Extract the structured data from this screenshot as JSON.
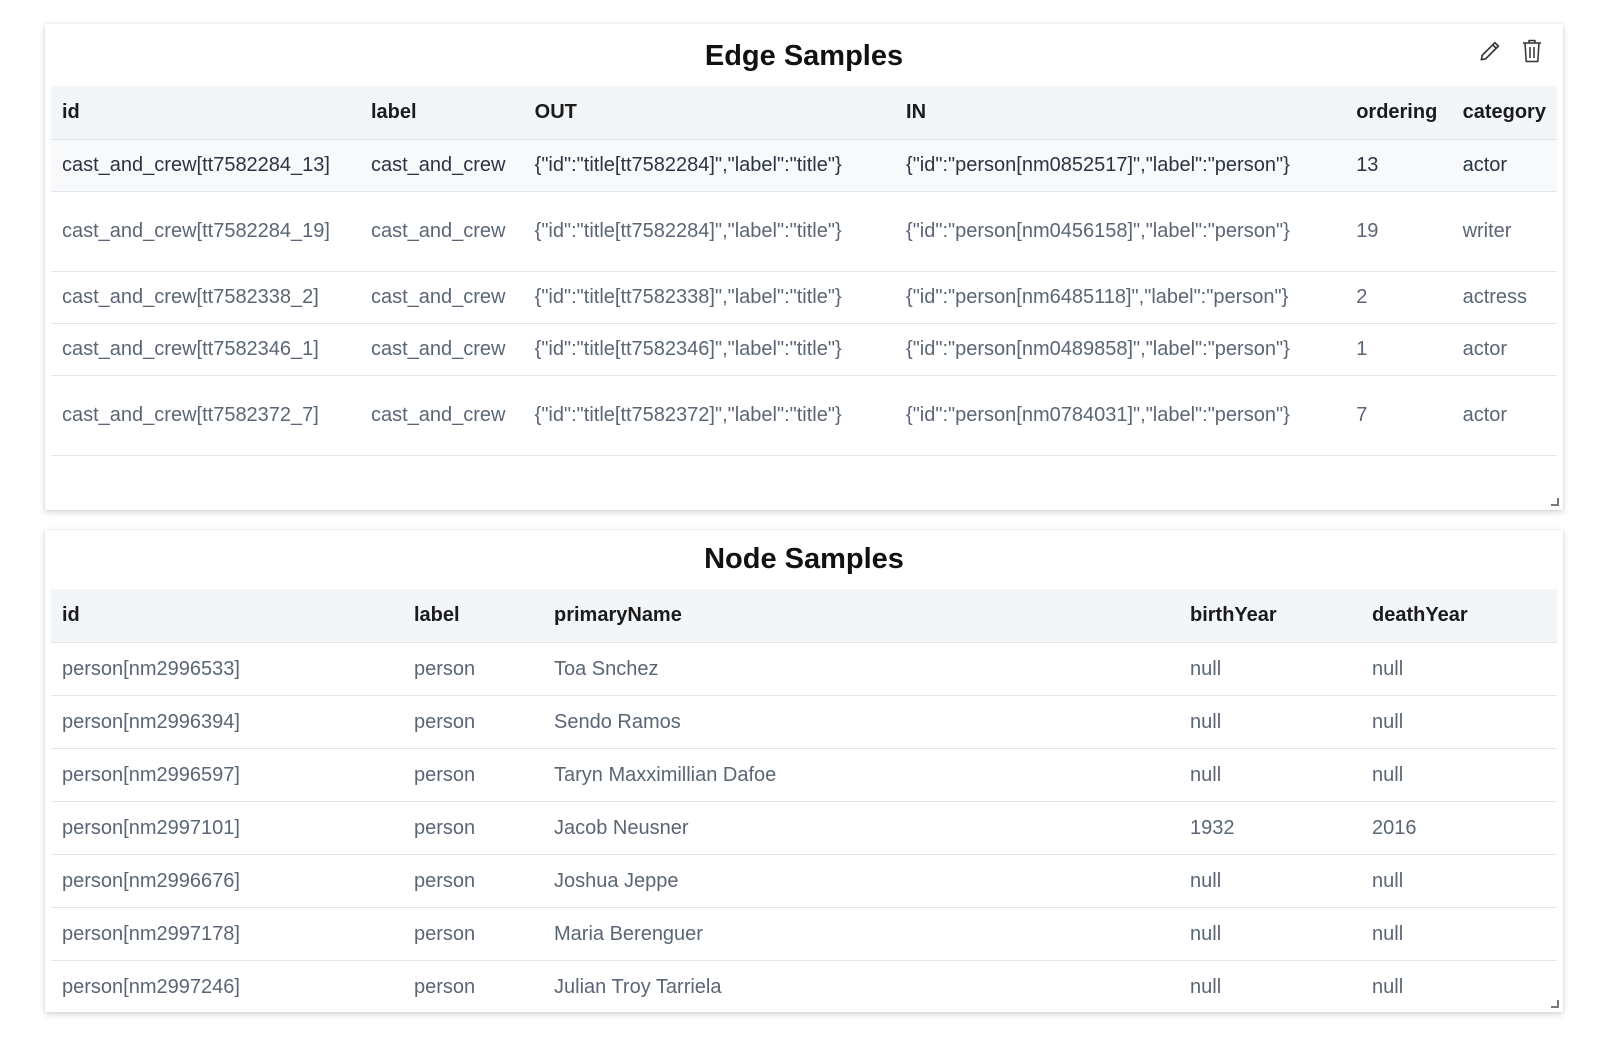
{
  "edge_panel": {
    "title": "Edge Samples",
    "actions": {
      "edit_icon": "pencil-icon",
      "delete_icon": "trash-icon"
    },
    "columns": [
      "id",
      "label",
      "OUT",
      "IN",
      "ordering",
      "category"
    ],
    "rows": [
      [
        "cast_and_crew[tt7582284_13]",
        "cast_and_crew",
        "{\"id\":\"title[tt7582284]\",\"label\":\"title\"}",
        "{\"id\":\"person[nm0852517]\",\"label\":\"person\"}",
        "13",
        "actor"
      ],
      [
        "cast_and_crew[tt7582284_19]",
        "cast_and_crew",
        "{\"id\":\"title[tt7582284]\",\"label\":\"title\"}",
        "{\"id\":\"person[nm0456158]\",\"label\":\"person\"}",
        "19",
        "writer"
      ],
      [
        "cast_and_crew[tt7582338_2]",
        "cast_and_crew",
        "{\"id\":\"title[tt7582338]\",\"label\":\"title\"}",
        "{\"id\":\"person[nm6485118]\",\"label\":\"person\"}",
        "2",
        "actress"
      ],
      [
        "cast_and_crew[tt7582346_1]",
        "cast_and_crew",
        "{\"id\":\"title[tt7582346]\",\"label\":\"title\"}",
        "{\"id\":\"person[nm0489858]\",\"label\":\"person\"}",
        "1",
        "actor"
      ],
      [
        "cast_and_crew[tt7582372_7]",
        "cast_and_crew",
        "{\"id\":\"title[tt7582372]\",\"label\":\"title\"}",
        "{\"id\":\"person[nm0784031]\",\"label\":\"person\"}",
        "7",
        "actor"
      ]
    ]
  },
  "node_panel": {
    "title": "Node Samples",
    "columns": [
      "id",
      "label",
      "primaryName",
      "birthYear",
      "deathYear"
    ],
    "rows": [
      [
        "person[nm2996533]",
        "person",
        "Toa Snchez",
        "null",
        "null"
      ],
      [
        "person[nm2996394]",
        "person",
        "Sendo Ramos",
        "null",
        "null"
      ],
      [
        "person[nm2996597]",
        "person",
        "Taryn Maxximillian Dafoe",
        "null",
        "null"
      ],
      [
        "person[nm2997101]",
        "person",
        "Jacob Neusner",
        "1932",
        "2016"
      ],
      [
        "person[nm2996676]",
        "person",
        "Joshua Jeppe",
        "null",
        "null"
      ],
      [
        "person[nm2997178]",
        "person",
        "Maria Berenguer",
        "null",
        "null"
      ],
      [
        "person[nm2997246]",
        "person",
        "Julian Troy Tarriela",
        "null",
        "null"
      ]
    ]
  }
}
